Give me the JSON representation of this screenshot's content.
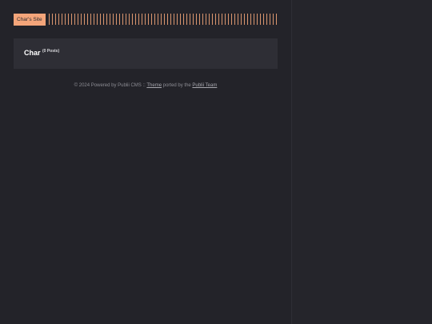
{
  "header": {
    "site_title": "Char's Site"
  },
  "author": {
    "name": "Char",
    "post_count": "(0 Posts)"
  },
  "footer": {
    "prefix": "© 2024 Powered by Publii CMS :: ",
    "theme_link": "Theme",
    "middle": " ported by the ",
    "team_link": "Publii Team"
  },
  "colors": {
    "background": "#232329",
    "accent": "#f4a57a",
    "card": "#2e2e35"
  }
}
